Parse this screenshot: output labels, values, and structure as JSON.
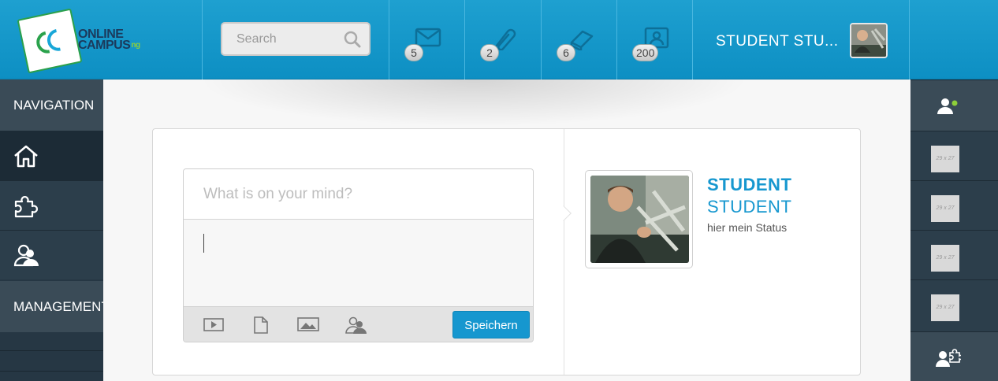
{
  "brand": {
    "line1": "ONLINE",
    "line2": "CAMPUS",
    "suffix": "ng"
  },
  "search": {
    "placeholder": "Search"
  },
  "notifications": [
    {
      "icon": "envelope-icon",
      "count": "5"
    },
    {
      "icon": "paperclip-icon",
      "count": "2"
    },
    {
      "icon": "book-icon",
      "count": "6"
    },
    {
      "icon": "contacts-icon",
      "count": "200"
    }
  ],
  "user": {
    "name": "STUDENT STU...",
    "avatar": "user-avatar"
  },
  "nav": {
    "section1": "NAVIGATION",
    "section2": "MANAGEMENT",
    "items": [
      {
        "icon": "home-icon"
      },
      {
        "icon": "puzzle-icon"
      },
      {
        "icon": "users-icon"
      }
    ]
  },
  "composer": {
    "title_placeholder": "What is on your mind?",
    "save_label": "Speichern",
    "tools": [
      "video-icon",
      "document-icon",
      "image-icon",
      "user-tag-icon"
    ]
  },
  "profile": {
    "first": "STUDENT",
    "last": "STUDENT",
    "status": "hier mein Status"
  },
  "right_sidebar": {
    "thumb_label": "29 x 27",
    "top_icon": "user-online-icon",
    "bottom_icon": "user-puzzle-icon"
  },
  "colors": {
    "header": "#1497cb",
    "accent": "#1697cf",
    "nav_bg": "#263744",
    "nav_head": "#3a4b57",
    "online": "#8ecf3a"
  }
}
